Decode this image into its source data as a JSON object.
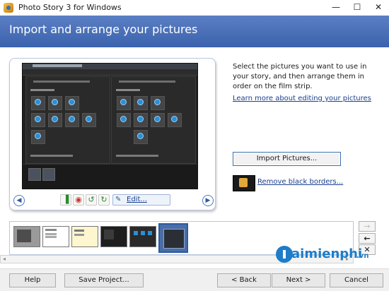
{
  "window": {
    "title": "Photo Story 3 for Windows",
    "minimize": "—",
    "maximize": "☐",
    "close": "✕"
  },
  "header": {
    "title": "Import and arrange your pictures",
    "background_color": "#3b62ad"
  },
  "preview": {
    "toolbar": {
      "prev_icon": "◀",
      "next_icon": "▶",
      "levels_icon": "▐",
      "red_eye_icon": "◉",
      "rotate_left_icon": "↺",
      "rotate_right_icon": "↻",
      "edit_icon": "✎",
      "edit_label": "Edit..."
    }
  },
  "instructions": {
    "text": "Select the pictures you want to use in your story, and then arrange them in order on the film strip.",
    "learn_more_link": "Learn more about editing your pictures"
  },
  "actions": {
    "import_label": "Import Pictures...",
    "remove_borders_label": "Remove black borders..."
  },
  "filmstrip": {
    "thumbnail_count": 6,
    "selected_index": 6,
    "scroll_left_icon": "◂",
    "scroll_right_icon": "▸"
  },
  "side_buttons": {
    "move_right_icon": "→",
    "move_left_icon": "←",
    "delete_icon": "✕"
  },
  "watermark": {
    "text": "aimienphi",
    "suffix": ".vn"
  },
  "buttons": {
    "help": "Help",
    "save_project": "Save Project...",
    "back": "< Back",
    "next": "Next >",
    "cancel": "Cancel"
  }
}
